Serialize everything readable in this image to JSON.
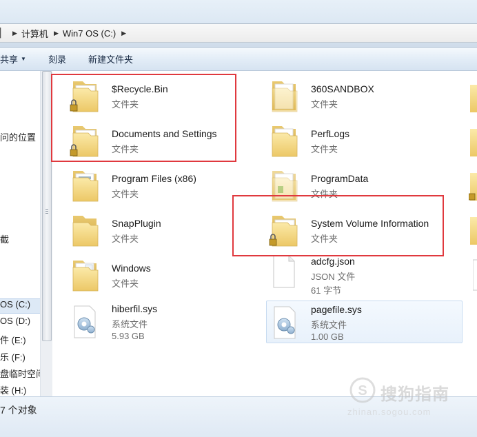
{
  "address": {
    "crumb_partial": "▏",
    "crumb_computer": "计算机",
    "crumb_drive": "Win7 OS (C:)"
  },
  "toolbar": {
    "share": "共享",
    "burn": "刻录",
    "new_folder": "新建文件夹"
  },
  "nav": {
    "items": [
      {
        "label": "问的位置"
      },
      {
        "label": "截"
      },
      {
        "label": "OS (C:)"
      },
      {
        "label": "OS (D:)"
      },
      {
        "label": "件 (E:)"
      },
      {
        "label": "乐 (F:)"
      },
      {
        "label": "盘临时空间"
      },
      {
        "label": "装 (H:)"
      }
    ]
  },
  "files": [
    {
      "name": "$Recycle.Bin",
      "type": "文件夹",
      "icon": "locked-folder-icon"
    },
    {
      "name": "360SANDBOX",
      "type": "文件夹",
      "icon": "folder-icon"
    },
    {
      "name": "Documents and Settings",
      "type": "文件夹",
      "icon": "locked-folder-icon"
    },
    {
      "name": "PerfLogs",
      "type": "文件夹",
      "icon": "folder-icon"
    },
    {
      "name": "Program Files (x86)",
      "type": "文件夹",
      "icon": "folder-icon"
    },
    {
      "name": "ProgramData",
      "type": "文件夹",
      "icon": "folder-icon"
    },
    {
      "name": "SnapPlugin",
      "type": "文件夹",
      "icon": "folder-icon"
    },
    {
      "name": "System Volume Information",
      "type": "文件夹",
      "icon": "locked-folder-icon"
    },
    {
      "name": "Windows",
      "type": "文件夹",
      "icon": "folder-icon"
    },
    {
      "name": "adcfg.json",
      "type": "JSON 文件",
      "size": "61 字节",
      "icon": "json-file-icon"
    },
    {
      "name": "hiberfil.sys",
      "type": "系统文件",
      "size": "5.93 GB",
      "icon": "system-file-icon"
    },
    {
      "name": "pagefile.sys",
      "type": "系统文件",
      "size": "1.00 GB",
      "icon": "system-file-icon"
    }
  ],
  "status": {
    "count": "7 个对象"
  },
  "watermark": {
    "brand": "搜狗指南",
    "url": "zhinan.sogou.com"
  },
  "colors": {
    "highlight_box": "#e0393e",
    "selection": "#e8f1fb"
  }
}
